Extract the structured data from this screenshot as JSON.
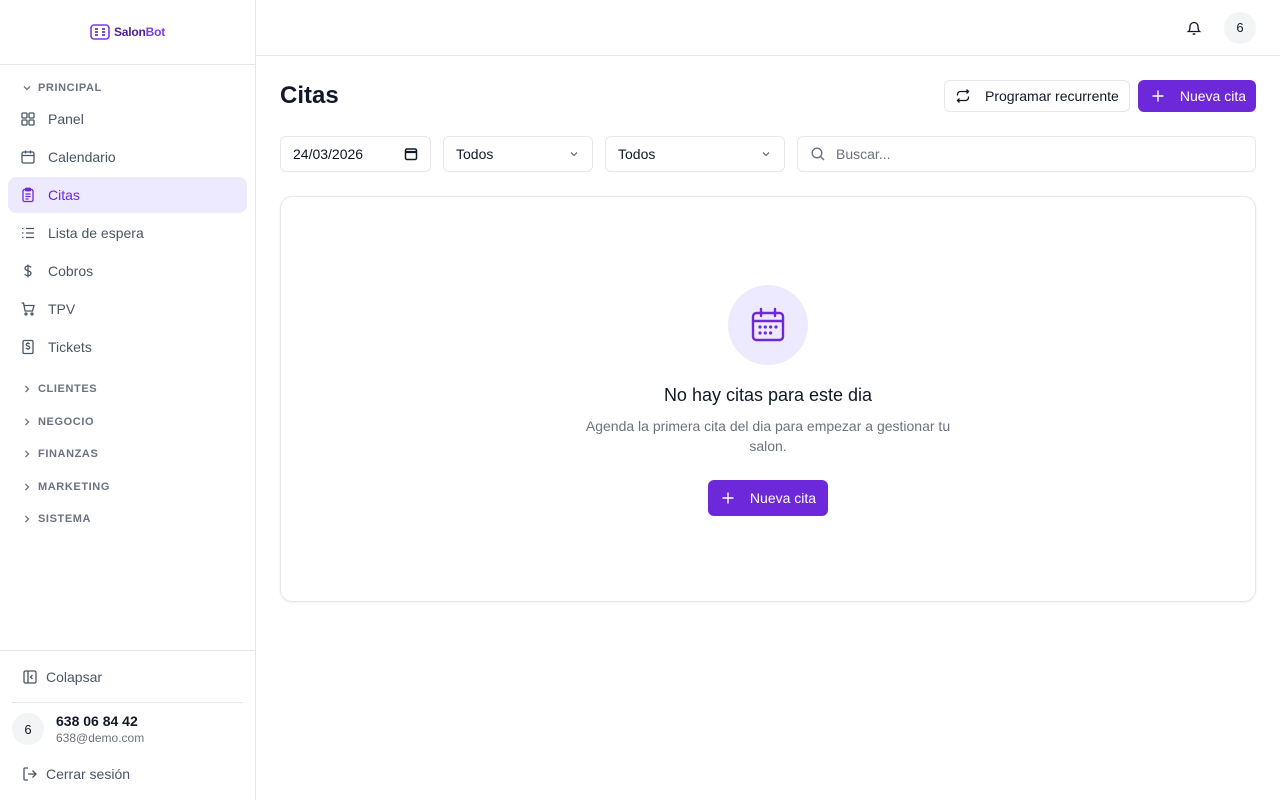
{
  "brand": {
    "name_prefix": "Salon",
    "name_suffix": "Bot"
  },
  "sidebar": {
    "principal_label": "PRINCIPAL",
    "items": [
      {
        "label": "Panel",
        "icon": "grid-icon"
      },
      {
        "label": "Calendario",
        "icon": "calendar-icon"
      },
      {
        "label": "Citas",
        "icon": "clipboard-icon",
        "active": true
      },
      {
        "label": "Lista de espera",
        "icon": "list-icon"
      },
      {
        "label": "Cobros",
        "icon": "dollar-icon"
      },
      {
        "label": "TPV",
        "icon": "cart-icon"
      },
      {
        "label": "Tickets",
        "icon": "receipt-icon"
      }
    ],
    "sections": [
      "CLIENTES",
      "NEGOCIO",
      "FINANZAS",
      "MARKETING",
      "SISTEMA"
    ],
    "collapse_label": "Colapsar",
    "user": {
      "initial": "6",
      "name": "638 06 84 42",
      "email": "638@demo.com"
    },
    "logout_label": "Cerrar sesión"
  },
  "topbar": {
    "avatar_initial": "6"
  },
  "main": {
    "title": "Citas",
    "recurring_label": "Programar recurrente",
    "new_label": "Nueva cita",
    "filters": {
      "date_value": "24/03/2026",
      "select1": "Todos",
      "select2": "Todos",
      "search_placeholder": "Buscar..."
    },
    "empty": {
      "title": "No hay citas para este dia",
      "description": "Agenda la primera cita del dia para empezar a gestionar tu salon.",
      "button_label": "Nueva cita"
    }
  },
  "colors": {
    "accent": "#6d28d9",
    "accent_soft": "#ede9fe"
  }
}
